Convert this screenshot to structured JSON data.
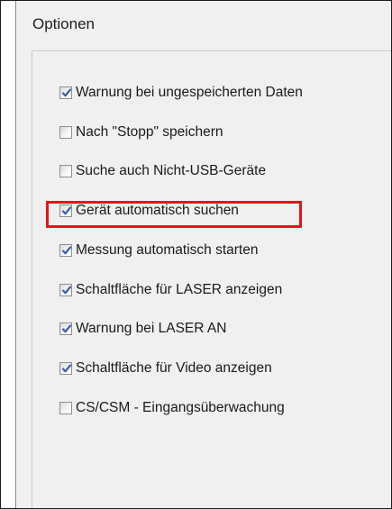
{
  "window": {
    "title": "Optionen"
  },
  "options": [
    {
      "label": "Warnung bei ungespeicherten Daten",
      "checked": true
    },
    {
      "label": "Nach \"Stopp\" speichern",
      "checked": false
    },
    {
      "label": "Suche auch Nicht-USB-Geräte",
      "checked": false
    },
    {
      "label": "Gerät automatisch suchen",
      "checked": true,
      "highlighted": true
    },
    {
      "label": "Messung automatisch starten",
      "checked": true
    },
    {
      "label": "Schaltfläche für LASER anzeigen",
      "checked": true
    },
    {
      "label": "Warnung bei LASER AN",
      "checked": true
    },
    {
      "label": "Schaltfläche für Video anzeigen",
      "checked": true
    },
    {
      "label": "CS/CSM - Eingangsüberwachung",
      "checked": false
    }
  ],
  "colors": {
    "highlight_border": "#e8121b",
    "checkmark": "#3b5fa8"
  }
}
